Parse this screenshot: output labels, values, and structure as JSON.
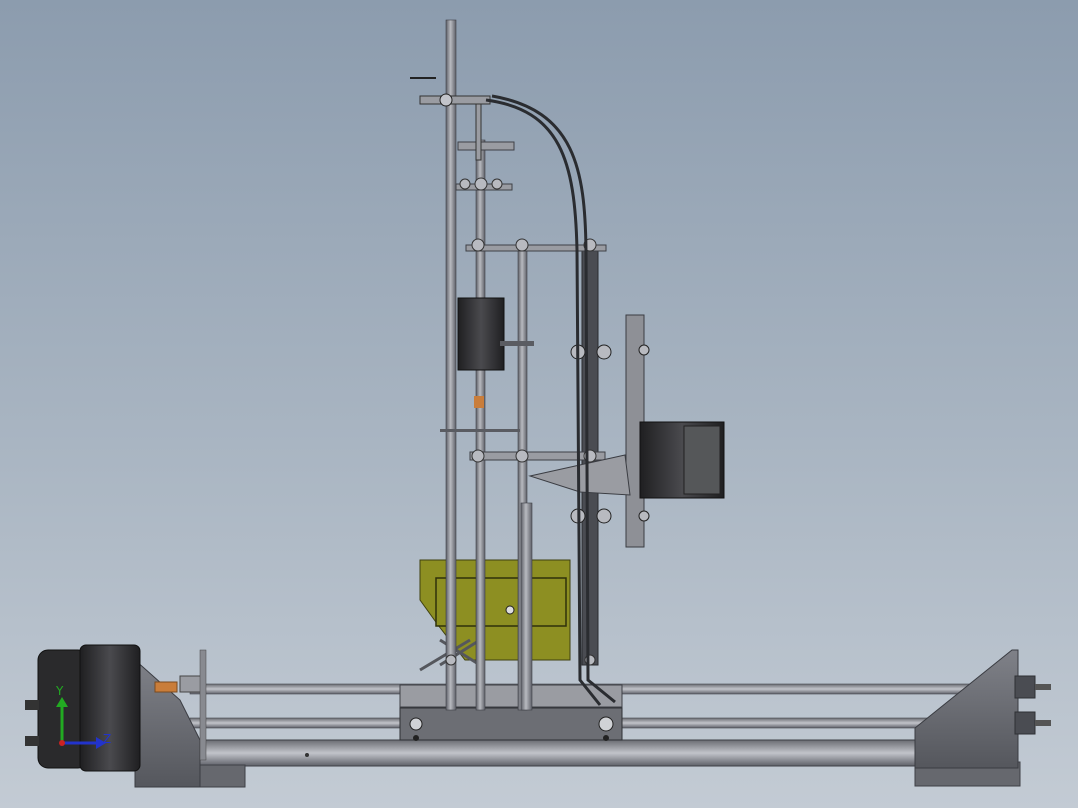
{
  "app": {
    "view": "cad-3d-viewport",
    "background_top": "#8c9cae",
    "background_bottom": "#c3cbd4"
  },
  "model": {
    "parts": [
      "base-rail-frame",
      "y-axis-smooth-rods",
      "y-axis-stepper-motor",
      "right-end-plate",
      "left-end-plate",
      "carriage-block",
      "z-axis-threaded-rods",
      "z-axis-stepper-motor",
      "extruder-motor",
      "olive-extruder-block",
      "filament-cable"
    ],
    "colors": {
      "steel": "#8e9096",
      "steel_dark": "#5a5c62",
      "motor_black": "#2a2a2c",
      "olive_part": "#8d8f22",
      "copper": "#c97d3a"
    }
  },
  "triad": {
    "y_label": "Y",
    "z_label": "Z",
    "y_color": "#22aa22",
    "z_color": "#2233cc"
  }
}
